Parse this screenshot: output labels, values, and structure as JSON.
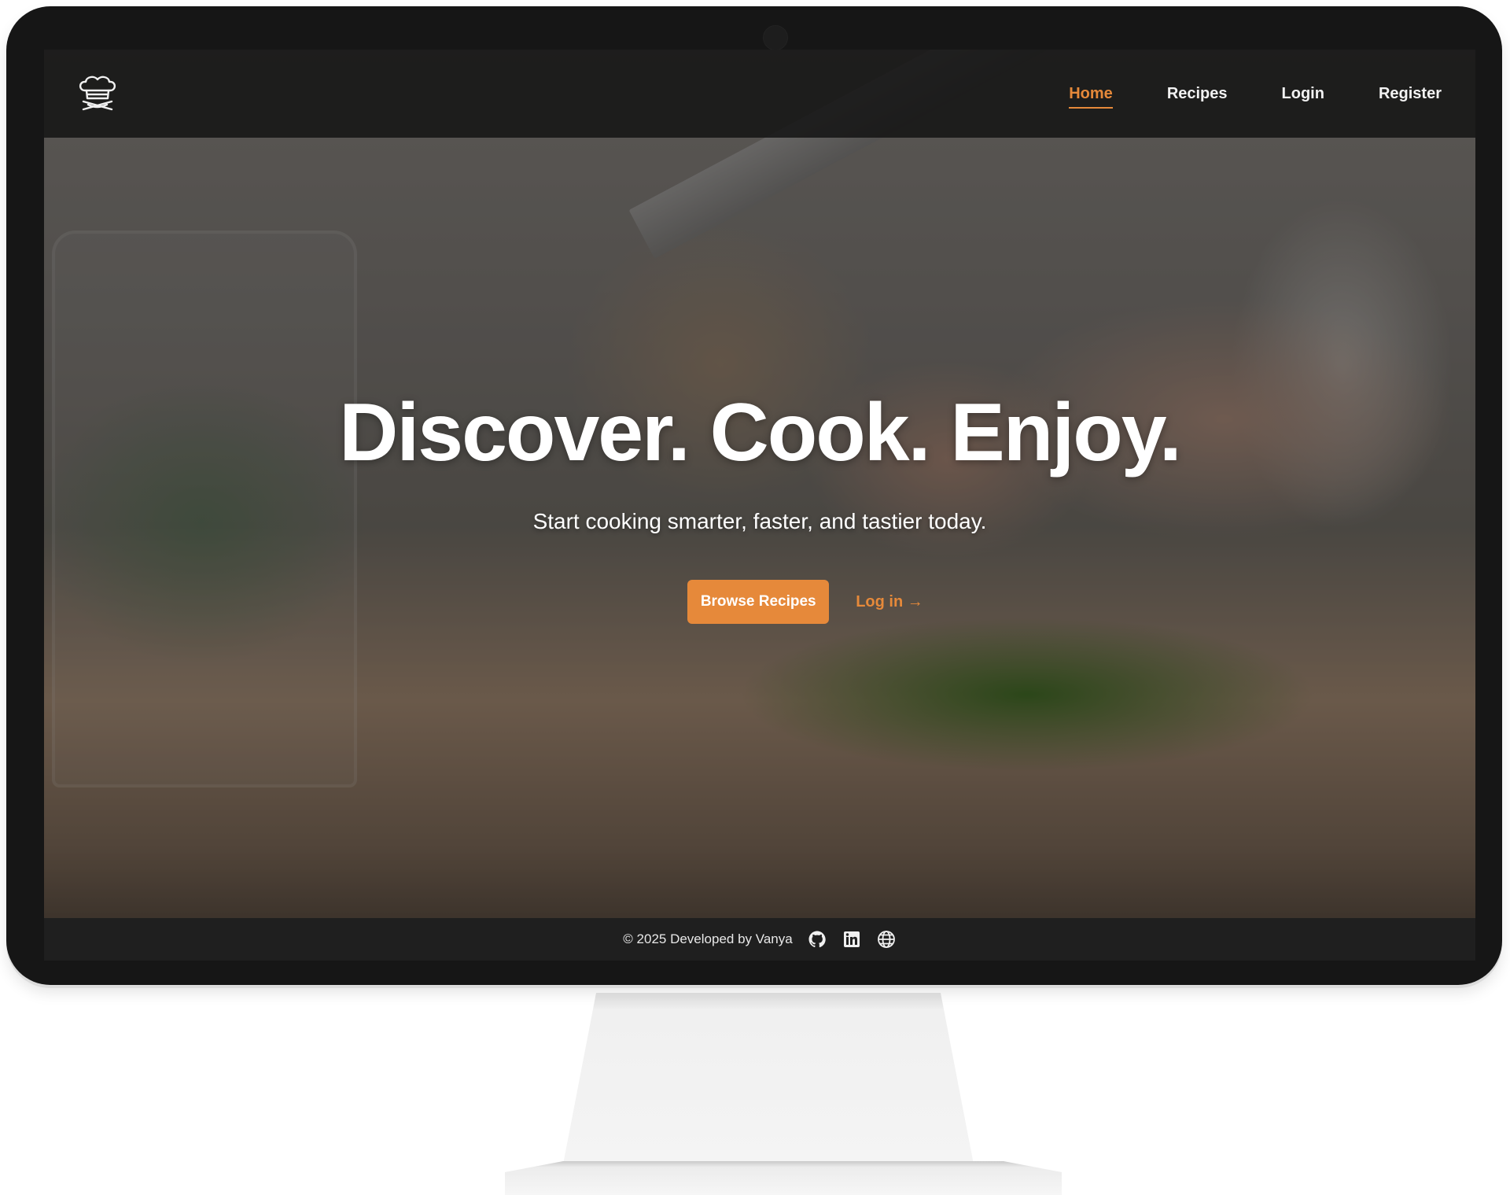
{
  "navbar": {
    "logo_icon": "chef-hat-logo-icon",
    "links": [
      {
        "label": "Home",
        "active": true
      },
      {
        "label": "Recipes",
        "active": false
      },
      {
        "label": "Login",
        "active": false
      },
      {
        "label": "Register",
        "active": false
      }
    ]
  },
  "hero": {
    "title": "Discover. Cook. Enjoy.",
    "subtitle": "Start cooking smarter, faster, and tastier today.",
    "primary_button": "Browse Recipes",
    "secondary_link": "Log in →"
  },
  "footer": {
    "text": "© 2025 Developed by Vanya",
    "icons": [
      "github-icon",
      "linkedin-icon",
      "globe-icon"
    ]
  },
  "colors": {
    "accent": "#e6893a",
    "navbar_bg": "#141414",
    "footer_bg": "#1f1f1f",
    "bezel": "#161616"
  }
}
